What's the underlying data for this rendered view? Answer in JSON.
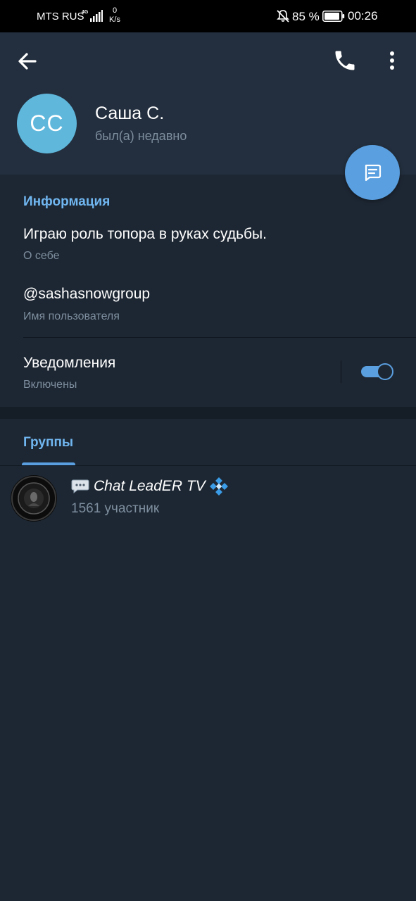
{
  "status_bar": {
    "carrier": "MTS RUS",
    "network": "4G",
    "speed_value": "0",
    "speed_unit": "K/s",
    "battery_percent": "85 %",
    "time": "00:26"
  },
  "header": {
    "avatar_initials": "CC",
    "name": "Саша С.",
    "status": "был(а) недавно"
  },
  "info": {
    "section_title": "Информация",
    "bio_value": "Играю роль топора в руках судьбы.",
    "bio_label": "О себе",
    "username_value": "@sashasnowgroup",
    "username_label": "Имя пользователя",
    "notifications_label": "Уведомления",
    "notifications_state": "Включены",
    "notifications_on": true
  },
  "tabs": {
    "groups_label": "Группы"
  },
  "groups": [
    {
      "name": "Chat LeadER TV",
      "members": "1561 участник"
    }
  ],
  "colors": {
    "accent": "#5a9fe0",
    "link": "#70b6f0",
    "avatar": "#5fb7dc",
    "background": "#1d2733",
    "header": "#232f3e"
  },
  "icons": [
    "back-arrow-icon",
    "phone-icon",
    "more-vert-icon",
    "message-icon",
    "speech-bubble-icon",
    "diamond-icon",
    "bell-off-icon",
    "battery-icon",
    "signal-icon"
  ]
}
